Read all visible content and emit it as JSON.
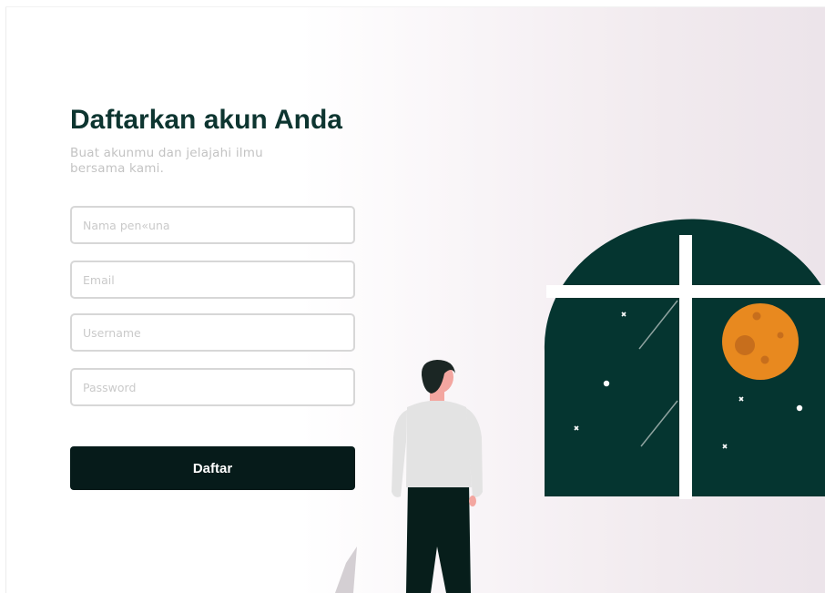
{
  "signup": {
    "title": "Daftarkan akun Anda",
    "subtitle": "Buat akunmu dan jelajahi ilmu bersama kami.",
    "fields": {
      "full_name": {
        "placeholder": "Nama pen«una"
      },
      "email": {
        "placeholder": "Email"
      },
      "username": {
        "placeholder": "Username"
      },
      "password": {
        "placeholder": "Password"
      }
    },
    "submit_label": "Daftar"
  },
  "colors": {
    "heading": "#0d3530",
    "button": "#061b1a",
    "window": "#053530",
    "moon": "#e8891f"
  }
}
